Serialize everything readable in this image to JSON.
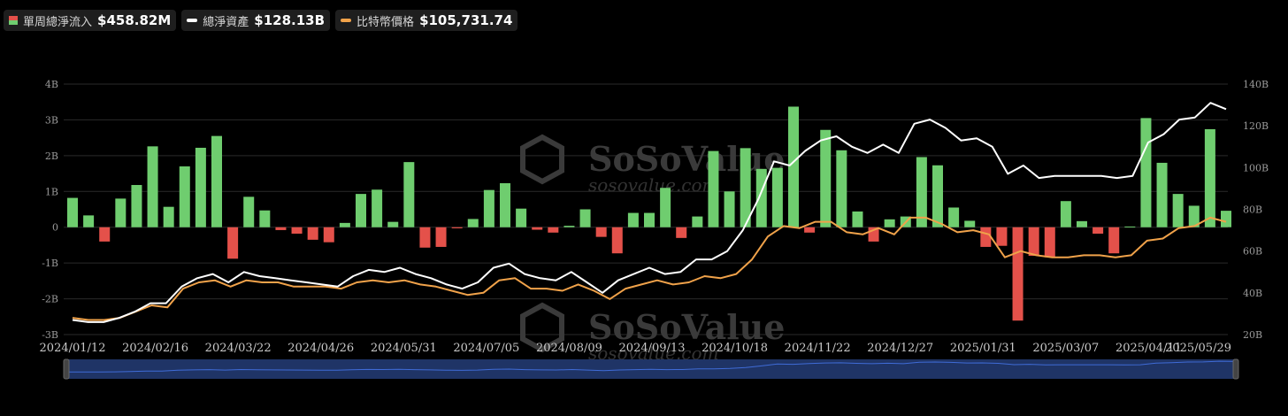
{
  "legend": {
    "flow": {
      "label": "單周總淨流入",
      "value": "$458.82M"
    },
    "assets": {
      "label": "總淨資產",
      "value": "$128.13B"
    },
    "btc": {
      "label": "比特幣價格",
      "value": "$105,731.74"
    }
  },
  "watermark": {
    "brand": "SoSoValue",
    "url": "sosovalue.com"
  },
  "colors": {
    "positive": "#6fcd6f",
    "negative": "#e4514a",
    "assets_line": "#ffffff",
    "btc_line": "#f0a24a",
    "grid": "#2a2a2a",
    "axis_text": "#9a9a9a",
    "navigator_fill": "#1f3466"
  },
  "chart_data": {
    "type": "bar",
    "x_tick_labels": [
      "2024/01/12",
      "2024/02/16",
      "2024/03/22",
      "2024/04/26",
      "2024/05/31",
      "2024/07/05",
      "2024/08/09",
      "2024/09/13",
      "2024/10/18",
      "2024/11/22",
      "2024/12/27",
      "2025/01/31",
      "2025/03/07",
      "2025/04/11",
      "2025/05/29"
    ],
    "left_axis": {
      "ticks": [
        "4B",
        "3B",
        "2B",
        "1B",
        "0",
        "-1B",
        "-2B",
        "-3B"
      ],
      "range": [
        -3,
        4
      ],
      "unit": "B"
    },
    "right_axis": {
      "ticks": [
        "140B",
        "120B",
        "100B",
        "80B",
        "60B",
        "40B",
        "20B"
      ],
      "range": [
        20,
        140
      ],
      "unit": "B"
    },
    "grid": true,
    "series": [
      {
        "kind": "bar",
        "values": [
          0.82,
          0.33,
          -0.4,
          0.8,
          1.18,
          2.26,
          0.57,
          1.7,
          2.22,
          2.55,
          -0.88,
          0.85,
          0.47,
          -0.08,
          -0.18,
          -0.35,
          -0.42,
          0.12,
          0.93,
          1.05,
          0.15,
          1.82,
          -0.57,
          -0.55,
          -0.03,
          0.23,
          1.04,
          1.23,
          0.52,
          -0.07,
          -0.15,
          0.04,
          0.5,
          -0.27,
          -0.73,
          0.4,
          0.4,
          1.1,
          -0.3,
          0.3,
          2.13,
          1.0,
          2.21,
          1.63,
          1.66,
          3.37,
          -0.15,
          2.72,
          2.15,
          0.44,
          -0.4,
          0.22,
          0.3,
          1.96,
          1.73,
          0.55,
          0.18,
          -0.55,
          -0.52,
          -2.61,
          -0.8,
          -0.84,
          0.73,
          0.17,
          -0.18,
          -0.73,
          0.02,
          3.05,
          1.8,
          0.93,
          0.6,
          2.74,
          0.46
        ]
      },
      {
        "kind": "line",
        "values": [
          27,
          26,
          26,
          28,
          31,
          35,
          35,
          43,
          47,
          49,
          45,
          50,
          48,
          47,
          46,
          45,
          44,
          43,
          48,
          51,
          50,
          52,
          49,
          47,
          44,
          42,
          45,
          52,
          54,
          49,
          47,
          46,
          50,
          45,
          40,
          46,
          49,
          52,
          49,
          50,
          56,
          56,
          60,
          70,
          85,
          103,
          101,
          108,
          113,
          115,
          110,
          107,
          111,
          107,
          121,
          123,
          119,
          113,
          114,
          110,
          97,
          101,
          95,
          96,
          96,
          96,
          96,
          95,
          96,
          112,
          116,
          123,
          124,
          131,
          128
        ]
      },
      {
        "kind": "line",
        "values": [
          28,
          27,
          27,
          28,
          31,
          34,
          33,
          42,
          45,
          46,
          43,
          46,
          45,
          45,
          43,
          43,
          43,
          42,
          45,
          46,
          45,
          46,
          44,
          43,
          41,
          39,
          40,
          46,
          47,
          42,
          42,
          41,
          44,
          41,
          37,
          42,
          44,
          46,
          44,
          45,
          48,
          47,
          49,
          56,
          67,
          72,
          71,
          74,
          74,
          69,
          68,
          71,
          68,
          76,
          76,
          73,
          69,
          70,
          68,
          57,
          60,
          58,
          57,
          57,
          58,
          58,
          57,
          58,
          65,
          66,
          71,
          72,
          76,
          74
        ]
      }
    ]
  }
}
